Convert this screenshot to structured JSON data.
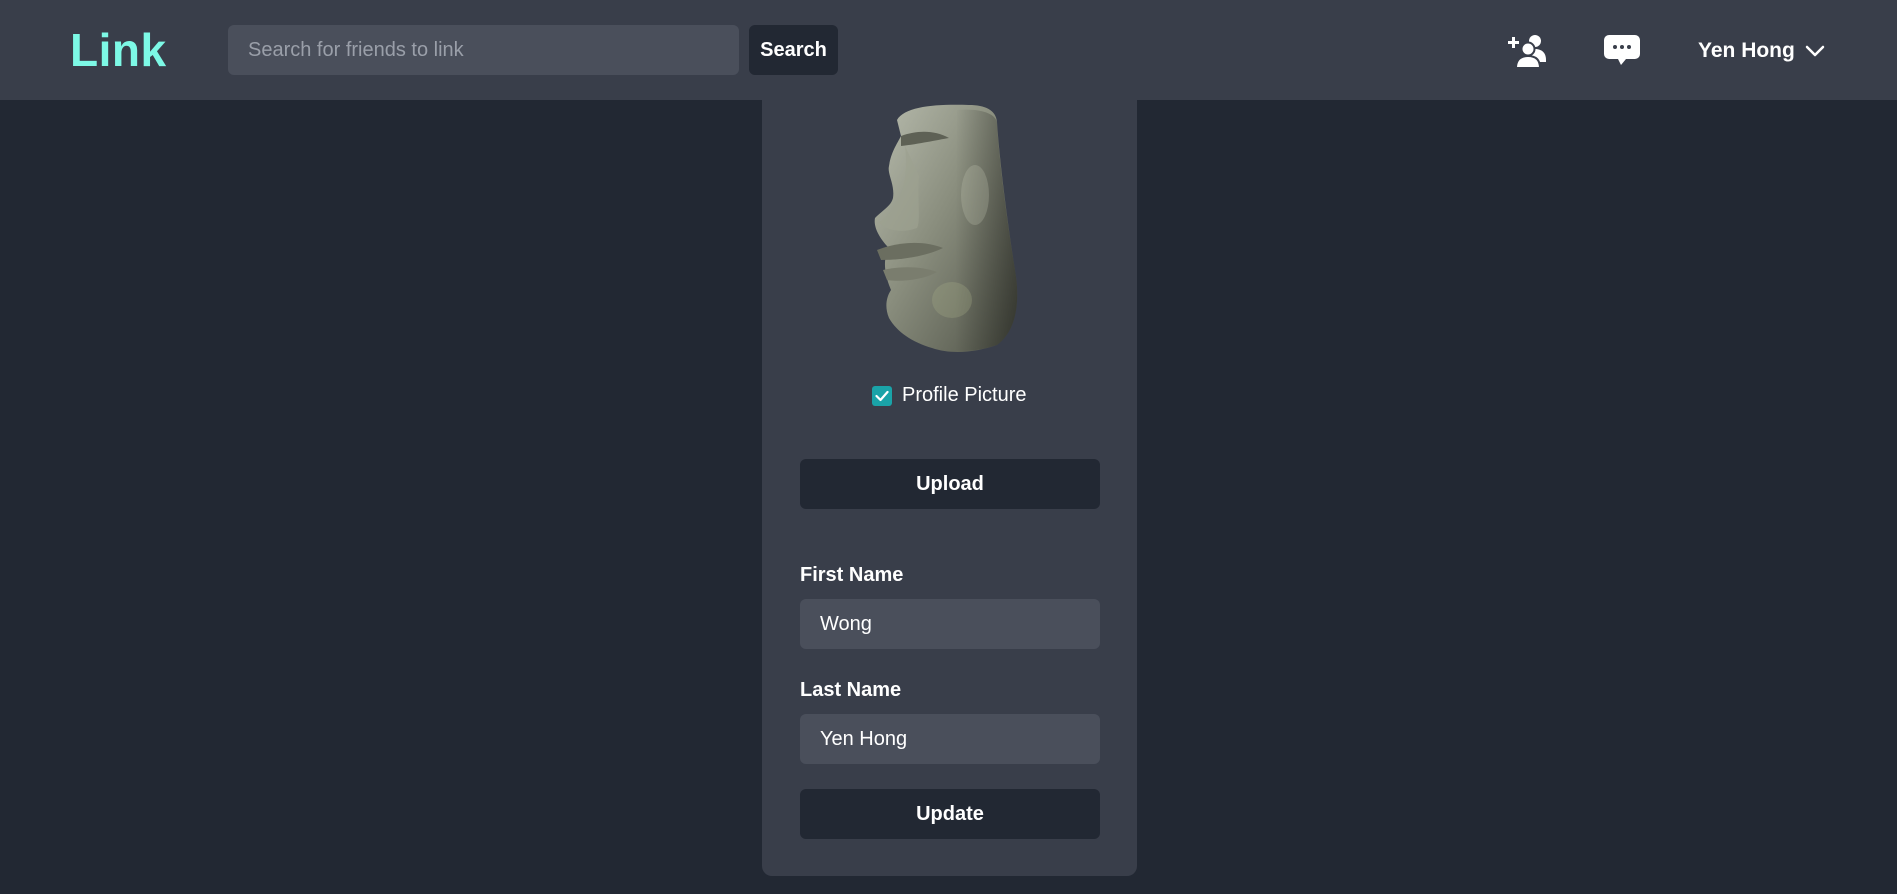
{
  "navbar": {
    "brand": "Link",
    "search_placeholder": "Search for friends to link",
    "search_button": "Search",
    "icons": [
      "add-friend-icon",
      "messages-icon"
    ],
    "user_name": "Yen Hong"
  },
  "profile": {
    "avatar_description": "moai-stone-head",
    "checkbox_checked": true,
    "checkbox_label": "Profile Picture",
    "upload_button": "Upload",
    "first_name_label": "First Name",
    "first_name_value": "Wong",
    "last_name_label": "Last Name",
    "last_name_value": "Yen Hong",
    "update_button": "Update"
  },
  "colors": {
    "background": "#222833",
    "navbar": "#393e4a",
    "card": "#393e4a",
    "brand": "#7df9e6",
    "input": "#4a4f5b",
    "checkbox": "#1aa3a8"
  }
}
